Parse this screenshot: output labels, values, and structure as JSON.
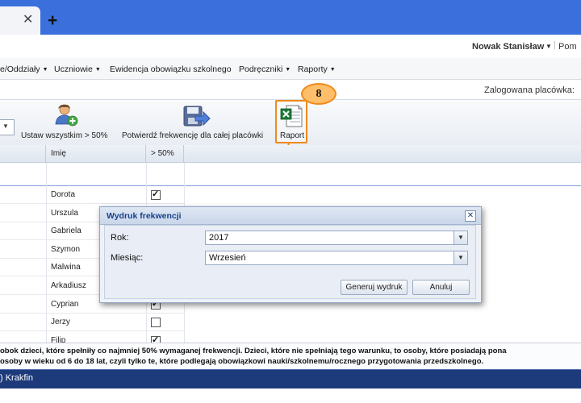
{
  "browser": {
    "tab_close": "✕",
    "new_tab": "+"
  },
  "header": {
    "user_name": "Nowak Stanisław",
    "help_link": "Pom"
  },
  "menu": {
    "items": [
      {
        "label": "e/Oddziały",
        "has_caret": true
      },
      {
        "label": "Uczniowie",
        "has_caret": true
      },
      {
        "label": "Ewidencja obowiązku szkolnego",
        "has_caret": false
      },
      {
        "label": "Podręczniki",
        "has_caret": true
      },
      {
        "label": "Raporty",
        "has_caret": true
      }
    ]
  },
  "infobar": {
    "logged_label": "Zalogowana placówka:"
  },
  "toolbar": {
    "set_all_label": "Ustaw wszystkim > 50%",
    "confirm_label": "Potwierdź frekwencję dla całej placówki",
    "report_label": "Raport"
  },
  "annotation": {
    "badge": "8",
    "accent": "#f08a1c"
  },
  "grid": {
    "columns": [
      "Imię",
      "> 50%"
    ],
    "rows": [
      {
        "name": "Dorota",
        "checked": true
      },
      {
        "name": "Urszula",
        "checked": false
      },
      {
        "name": "Gabriela",
        "checked": false
      },
      {
        "name": "Szymon",
        "checked": false
      },
      {
        "name": "Malwina",
        "checked": false
      },
      {
        "name": "Arkadiusz",
        "checked": false
      },
      {
        "name": "Cyprian",
        "checked": true
      },
      {
        "name": "Jerzy",
        "checked": false
      },
      {
        "name": "Filip",
        "checked": true
      }
    ]
  },
  "dialog": {
    "title": "Wydruk frekwencji",
    "year_label": "Rok:",
    "year_value": "2017",
    "month_label": "Miesiąc:",
    "month_value": "Wrzesień",
    "generate_button": "Generuj wydruk",
    "cancel_button": "Anuluj",
    "close": "✕"
  },
  "status": {
    "line1": "obok dzieci, które spełniły co najmniej 50% wymaganej frekwencji. Dzieci, które nie spełniają tego warunku, to osoby, które posiadają pona",
    "line2": "osoby w wieku od 6 do 18 lat, czyli tylko te, które podlegają obowiązkowi nauki/szkolnemu/rocznego przygotowania przedszkolnego."
  },
  "taskbar": {
    "label": ") Krakfin"
  }
}
